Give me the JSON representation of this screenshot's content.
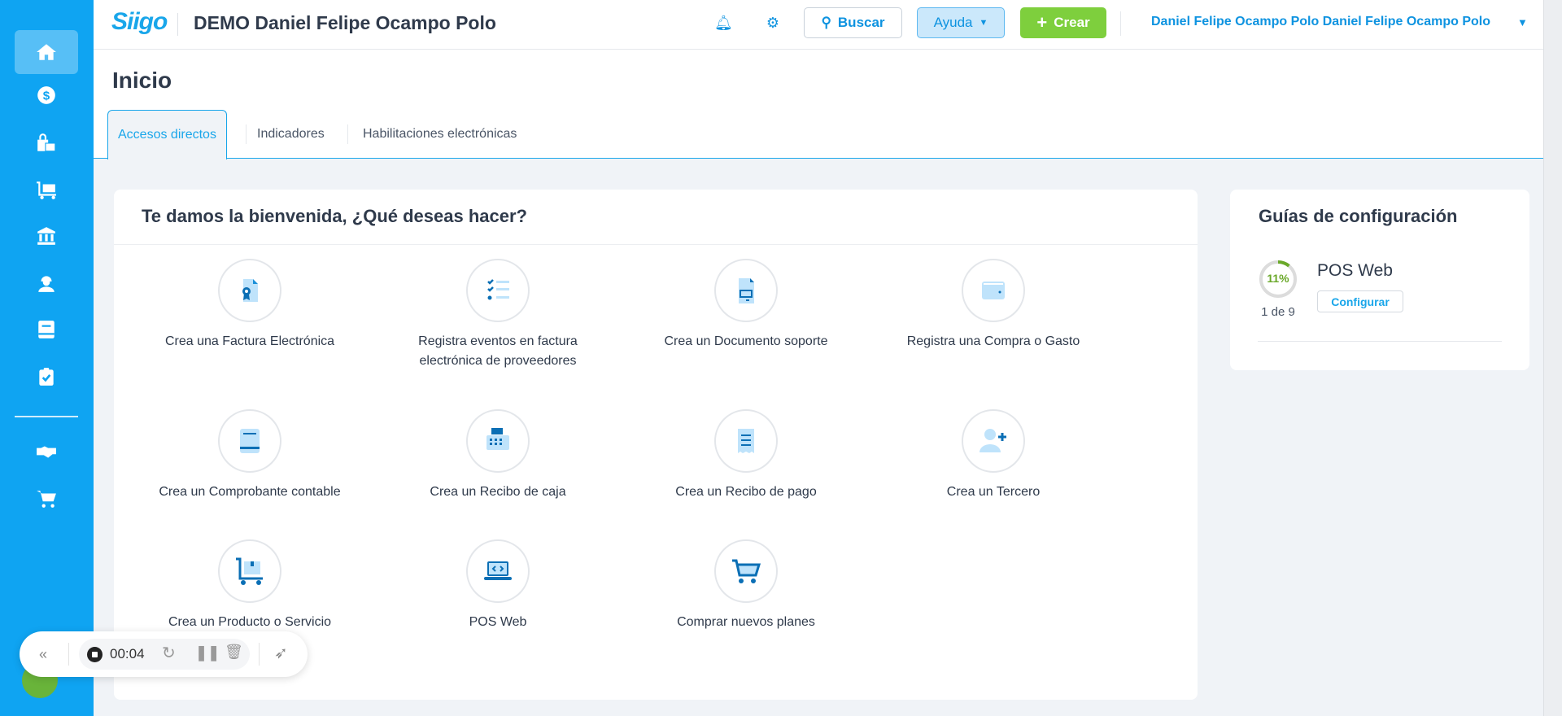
{
  "header": {
    "logo": "Siigo",
    "company": "DEMO Daniel Felipe Ocampo Polo",
    "search_label": "Buscar",
    "help_label": "Ayuda",
    "create_label": "Crear",
    "user": "Daniel Felipe Ocampo Polo Daniel Felipe Ocampo Polo"
  },
  "sidebar": {
    "items": [
      "home",
      "sales",
      "purchases",
      "inventory",
      "bank",
      "payroll",
      "accounting",
      "tasks",
      "partners",
      "store"
    ]
  },
  "page": {
    "title": "Inicio",
    "tabs": [
      "Accesos directos",
      "Indicadores",
      "Habilitaciones electrónicas"
    ]
  },
  "welcome": {
    "title": "Te damos la bienvenida, ¿Qué deseas hacer?",
    "shortcuts": [
      {
        "label": "Crea una Factura Electrónica",
        "icon": "invoice-certificate"
      },
      {
        "label": "Registra eventos en factura electrónica de proveedores",
        "icon": "checklist"
      },
      {
        "label": "Crea un Documento soporte",
        "icon": "document"
      },
      {
        "label": "Registra una Compra o Gasto",
        "icon": "wallet"
      },
      {
        "label": "Crea un Comprobante contable",
        "icon": "book"
      },
      {
        "label": "Crea un Recibo de caja",
        "icon": "cash-register"
      },
      {
        "label": "Crea un Recibo de pago",
        "icon": "receipt"
      },
      {
        "label": "Crea un Tercero",
        "icon": "user-plus"
      },
      {
        "label": "Crea un Producto o Servicio",
        "icon": "cart-box"
      },
      {
        "label": "POS Web",
        "icon": "laptop-code"
      },
      {
        "label": "Comprar nuevos planes",
        "icon": "shopping-cart"
      }
    ]
  },
  "guides": {
    "title": "Guías de configuración",
    "progress_label": "11%",
    "progress": 0.11,
    "count": "1 de 9",
    "name": "POS Web",
    "button": "Configurar"
  },
  "recorder": {
    "time": "00:04"
  },
  "colors": {
    "brand": "#0fa4f2",
    "green": "#7ecf3d"
  }
}
